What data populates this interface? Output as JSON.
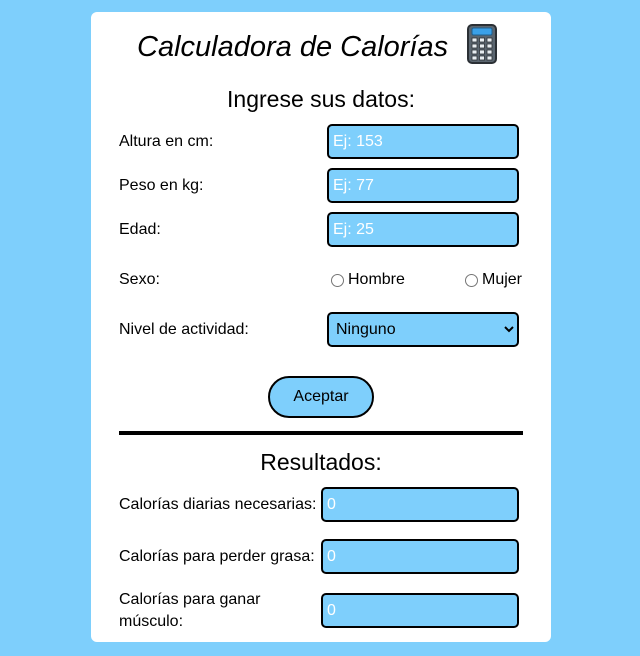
{
  "header": {
    "title": "Calculadora de Calorías",
    "icon": "calculator-icon"
  },
  "form": {
    "heading": "Ingrese sus datos:",
    "height": {
      "label": "Altura en cm:",
      "placeholder": "Ej: 153",
      "value": ""
    },
    "weight": {
      "label": "Peso en kg:",
      "placeholder": "Ej: 77",
      "value": ""
    },
    "age": {
      "label": "Edad:",
      "placeholder": "Ej: 25",
      "value": ""
    },
    "sex": {
      "label": "Sexo:",
      "options": [
        "Hombre",
        "Mujer"
      ]
    },
    "activity": {
      "label": "Nivel de actividad:",
      "selected": "Ninguno"
    },
    "submit_label": "Aceptar"
  },
  "results": {
    "heading": "Resultados:",
    "daily": {
      "label": "Calorías diarias necesarias:",
      "value": "0"
    },
    "lose_fat": {
      "label": "Calorías para perder grasa:",
      "value": "0"
    },
    "gain_muscle": {
      "label_line1": "Calorías para ganar",
      "label_line2": "músculo:",
      "value": "0"
    }
  },
  "colors": {
    "background": "#7ecffc",
    "card": "#ffffff",
    "field": "#7ecffc",
    "border": "#000000"
  }
}
